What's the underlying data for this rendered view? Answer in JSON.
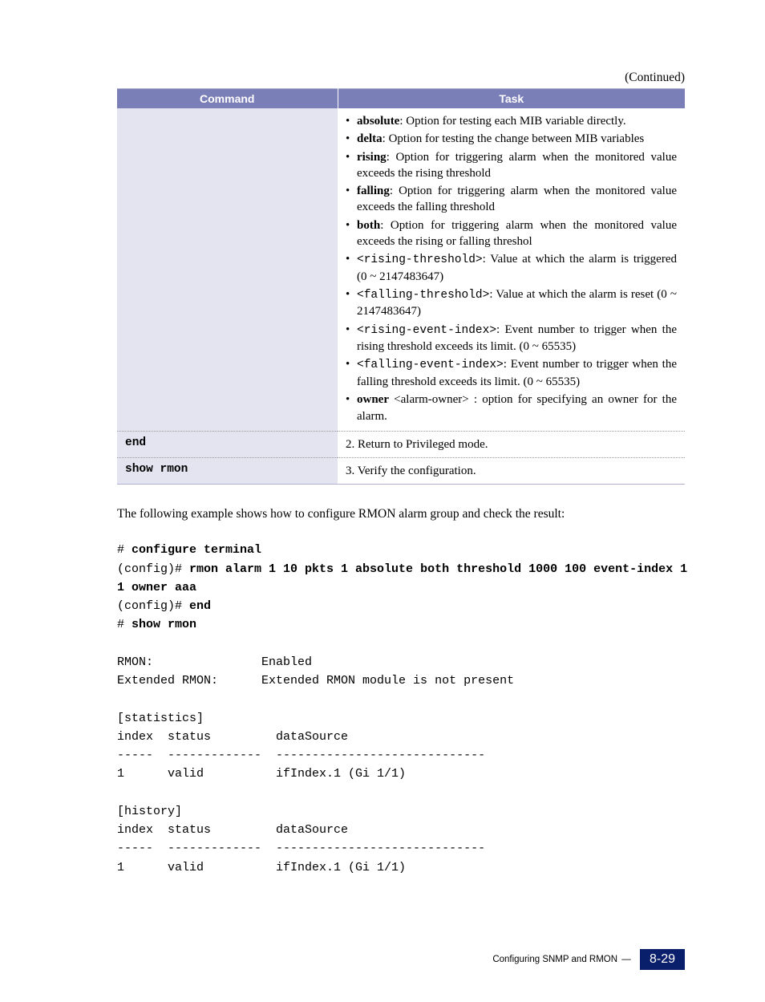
{
  "continued": "(Continued)",
  "table": {
    "headers": [
      "Command",
      "Task"
    ],
    "rows": [
      {
        "cmd": "",
        "task_bullets": [
          {
            "lead": "absolute",
            "lead_bold": true,
            "rest": ": Option for testing each MIB variable directly."
          },
          {
            "lead": "delta",
            "lead_bold": true,
            "rest": ": Option for testing the change between MIB variables"
          },
          {
            "lead": "rising",
            "lead_bold": true,
            "rest": ": Option for triggering alarm when the monitored value exceeds the rising threshold"
          },
          {
            "lead": "falling",
            "lead_bold": true,
            "rest": ": Option for triggering alarm when the monitored value exceeds the falling threshold"
          },
          {
            "lead": "both",
            "lead_bold": true,
            "rest": ": Option for triggering alarm when the monitored value exceeds the rising or falling threshol"
          },
          {
            "lead": "<rising-threshold>",
            "lead_mono": true,
            "rest": ": Value at which the alarm is triggered (0 ~ 2147483647)"
          },
          {
            "lead": "<falling-threshold>",
            "lead_mono": true,
            "rest": ": Value at which the alarm is reset (0 ~ 2147483647)"
          },
          {
            "lead": "<rising-event-index>",
            "lead_mono": true,
            "rest": ": Event number to trigger when the rising threshold exceeds its limit. (0 ~ 65535)"
          },
          {
            "lead": "<falling-event-index>",
            "lead_mono": true,
            "rest": ": Event number to trigger when the falling threshold exceeds its limit. (0 ~ 65535)"
          },
          {
            "lead": "owner",
            "lead_bold": true,
            "rest": " <alarm-owner> : option for specifying an owner for the alarm."
          }
        ]
      },
      {
        "cmd": "end",
        "task_text": "2. Return to Privileged mode."
      },
      {
        "cmd": "show rmon",
        "task_text": "3. Verify the configuration."
      }
    ]
  },
  "paragraph": "The following example shows how to configure RMON alarm group and check the result:",
  "terminal": {
    "l1a": "# ",
    "l1b": "configure terminal",
    "l2a": "(config)# ",
    "l2b": "rmon alarm 1 10 pkts 1 absolute both threshold 1000 100 event-index 1",
    "l3b": "1 owner aaa",
    "l4a": "(config)# ",
    "l4b": "end",
    "l5a": "# ",
    "l5b": "show rmon",
    "blank": "",
    "o1": "RMON:               Enabled",
    "o2": "Extended RMON:      Extended RMON module is not present",
    "o4": "[statistics]",
    "o5": "index  status         dataSource",
    "o6": "-----  -------------  -----------------------------",
    "o7": "1      valid          ifIndex.1 (Gi 1/1)",
    "o9": "[history]",
    "o10": "index  status         dataSource",
    "o11": "-----  -------------  -----------------------------",
    "o12": "1      valid          ifIndex.1 (Gi 1/1)"
  },
  "footer": {
    "section": "Configuring SNMP and RMON",
    "page": "8-29"
  }
}
